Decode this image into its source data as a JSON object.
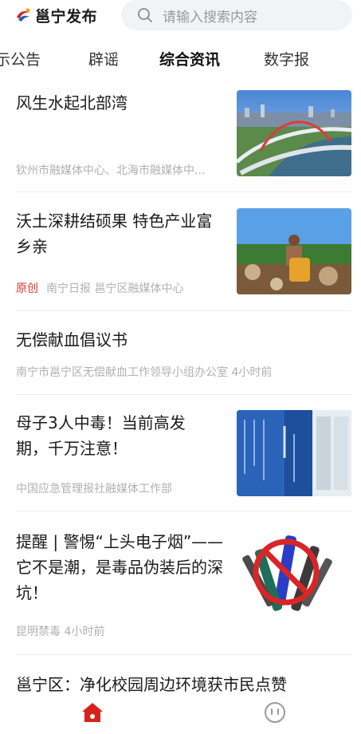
{
  "header": {
    "app_name": "邕宁发布",
    "search_placeholder": "请输入搜索内容"
  },
  "tabs": [
    {
      "label": "示公告"
    },
    {
      "label": "辟谣"
    },
    {
      "label": "综合资讯",
      "active": true
    },
    {
      "label": "数字报"
    }
  ],
  "feed": [
    {
      "title": "风生水起北部湾",
      "meta": "钦州市融媒体中心、北海市融媒体中...",
      "thumb": "bridge-city-photo"
    },
    {
      "title": "沃土深耕结硕果 特色产业富乡亲",
      "badge": "原创",
      "meta": "南宁日报 邕宁区融媒体中心",
      "thumb": "farmer-harvest-photo"
    },
    {
      "title": "无偿献血倡议书",
      "meta": "南宁市邕宁区无偿献血工作领导小组办公室  4小时前"
    },
    {
      "title": "母子3人中毒！当前高发期，千万注意！",
      "meta": "中国应急管理报社融媒体工作部",
      "thumb": "window-warning-photo"
    },
    {
      "title": "提醒 | 警惕“上头电子烟”——它不是潮，是毒品伪装后的深坑！",
      "meta": "昆明禁毒  4小时前",
      "thumb": "no-ecigarette-illustration"
    },
    {
      "title": "邕宁区：净化校园周边环境获市民点赞"
    }
  ],
  "bottom_nav": {
    "home_icon": "home-icon",
    "me_icon": "face-icon",
    "accent": "#d5231c"
  }
}
